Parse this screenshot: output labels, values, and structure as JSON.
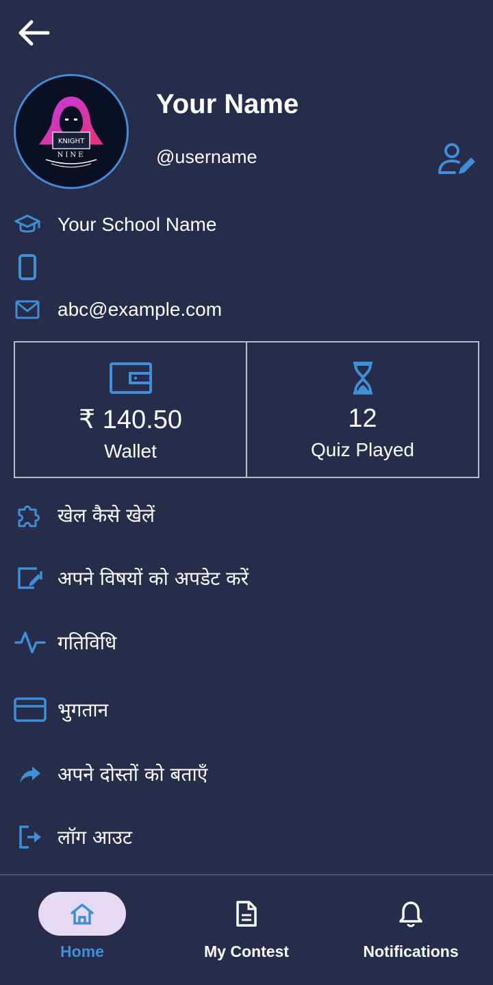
{
  "header": {
    "back_icon": "arrow-left-icon"
  },
  "profile": {
    "name": "Your Name",
    "username": "@username",
    "avatar_text_top": "KNIGHT",
    "avatar_text_bottom": "NINE",
    "edit_icon": "user-edit-icon"
  },
  "info": {
    "school": "Your School Name",
    "phone": "",
    "email": "abc@example.com"
  },
  "stats": {
    "wallet_value": "₹ 140.50",
    "wallet_label": "Wallet",
    "quiz_value": "12",
    "quiz_label": "Quiz Played"
  },
  "menu": [
    {
      "label": "खेल कैसे खेलें",
      "icon": "puzzle-icon"
    },
    {
      "label": "अपने विषयों को अपडेट करें",
      "icon": "edit-box-icon"
    },
    {
      "label": "गतिविधि",
      "icon": "activity-icon"
    },
    {
      "label": "भुगतान",
      "icon": "credit-card-icon"
    },
    {
      "label": "अपने दोस्तों को बताएँ",
      "icon": "share-arrow-icon"
    },
    {
      "label": "लॉग आउट",
      "icon": "logout-icon"
    }
  ],
  "nav": {
    "home": "Home",
    "contest": "My Contest",
    "notifications": "Notifications",
    "active": "home"
  },
  "colors": {
    "background": "#262c4a",
    "accent": "#3f8fd6",
    "active_pill": "#e6d9f6"
  }
}
